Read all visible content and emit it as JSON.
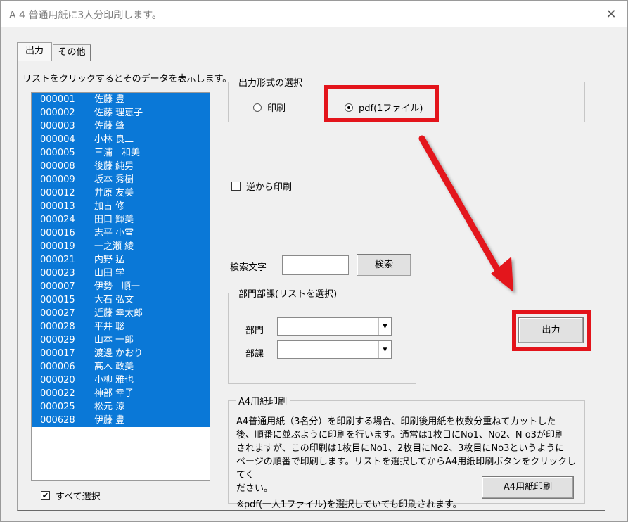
{
  "window": {
    "title": "A 4 普通用紙に3人分印刷します。",
    "close_glyph": "✕"
  },
  "tabs": [
    {
      "label": "出力"
    },
    {
      "label": "その他"
    }
  ],
  "list": {
    "caption": "リストをクリックするとそのデータを表示します。",
    "items": [
      {
        "code": "000001",
        "name": "佐藤 豊"
      },
      {
        "code": "000002",
        "name": "佐藤 理恵子"
      },
      {
        "code": "000003",
        "name": "佐藤 肇"
      },
      {
        "code": "000004",
        "name": "小林 良二"
      },
      {
        "code": "000005",
        "name": "三浦　和美"
      },
      {
        "code": "000008",
        "name": "後藤 純男"
      },
      {
        "code": "000009",
        "name": "坂本 秀樹"
      },
      {
        "code": "000012",
        "name": "井原 友美"
      },
      {
        "code": "000013",
        "name": "加古 修"
      },
      {
        "code": "000024",
        "name": "田口 輝美"
      },
      {
        "code": "000016",
        "name": "志平 小雪"
      },
      {
        "code": "000019",
        "name": "一之瀬 綾"
      },
      {
        "code": "000021",
        "name": "内野 猛"
      },
      {
        "code": "000023",
        "name": "山田 学"
      },
      {
        "code": "000007",
        "name": "伊勢　順一"
      },
      {
        "code": "000015",
        "name": "大石 弘文"
      },
      {
        "code": "000027",
        "name": "近藤 幸太郎"
      },
      {
        "code": "000028",
        "name": "平井 聡"
      },
      {
        "code": "000029",
        "name": "山本 一郎"
      },
      {
        "code": "000017",
        "name": "渡邊 かおり"
      },
      {
        "code": "000006",
        "name": "髙木 政美"
      },
      {
        "code": "000020",
        "name": "小柳 雅也"
      },
      {
        "code": "000022",
        "name": "神部 幸子"
      },
      {
        "code": "000025",
        "name": "松元 涼"
      },
      {
        "code": "000628",
        "name": "伊藤 豊"
      }
    ],
    "select_all_label": "すべて選択",
    "select_all_checked": true
  },
  "output_format": {
    "group_label": "出力形式の選択",
    "options": [
      {
        "label": "印刷",
        "selected": false
      },
      {
        "label": "pdf(1ファイル)",
        "selected": true
      }
    ]
  },
  "reverse_print": {
    "label": "逆から印刷",
    "checked": false
  },
  "search": {
    "label": "検索文字",
    "value": "",
    "button_label": "検索"
  },
  "department": {
    "group_label": "部門部課(リストを選択)",
    "dept_label": "部門",
    "dept_value": "",
    "section_label": "部課",
    "section_value": ""
  },
  "output_button_label": "出力",
  "a4": {
    "group_label": "A4用紙印刷",
    "description": [
      "A4普通用紙（3名分）を印刷する場合、印刷後用紙を枚数分重ねてカットした",
      "後、順番に並ぶように印刷を行います。通常は1枚目にNo1、No2、N o3が印刷",
      "されますが、この印刷は1枚目にNo1、2枚目にNo2、3枚目にNo3というように",
      "ページの順番で印刷します。リストを選択してからA4用紙印刷ボタンをクリックしてく",
      "ださい。",
      "※pdf(一人1ファイル)を選択していても印刷されます。"
    ],
    "button_label": "A4用紙印刷"
  },
  "colors": {
    "selection": "#0a78d7",
    "highlight": "#e3141b"
  }
}
